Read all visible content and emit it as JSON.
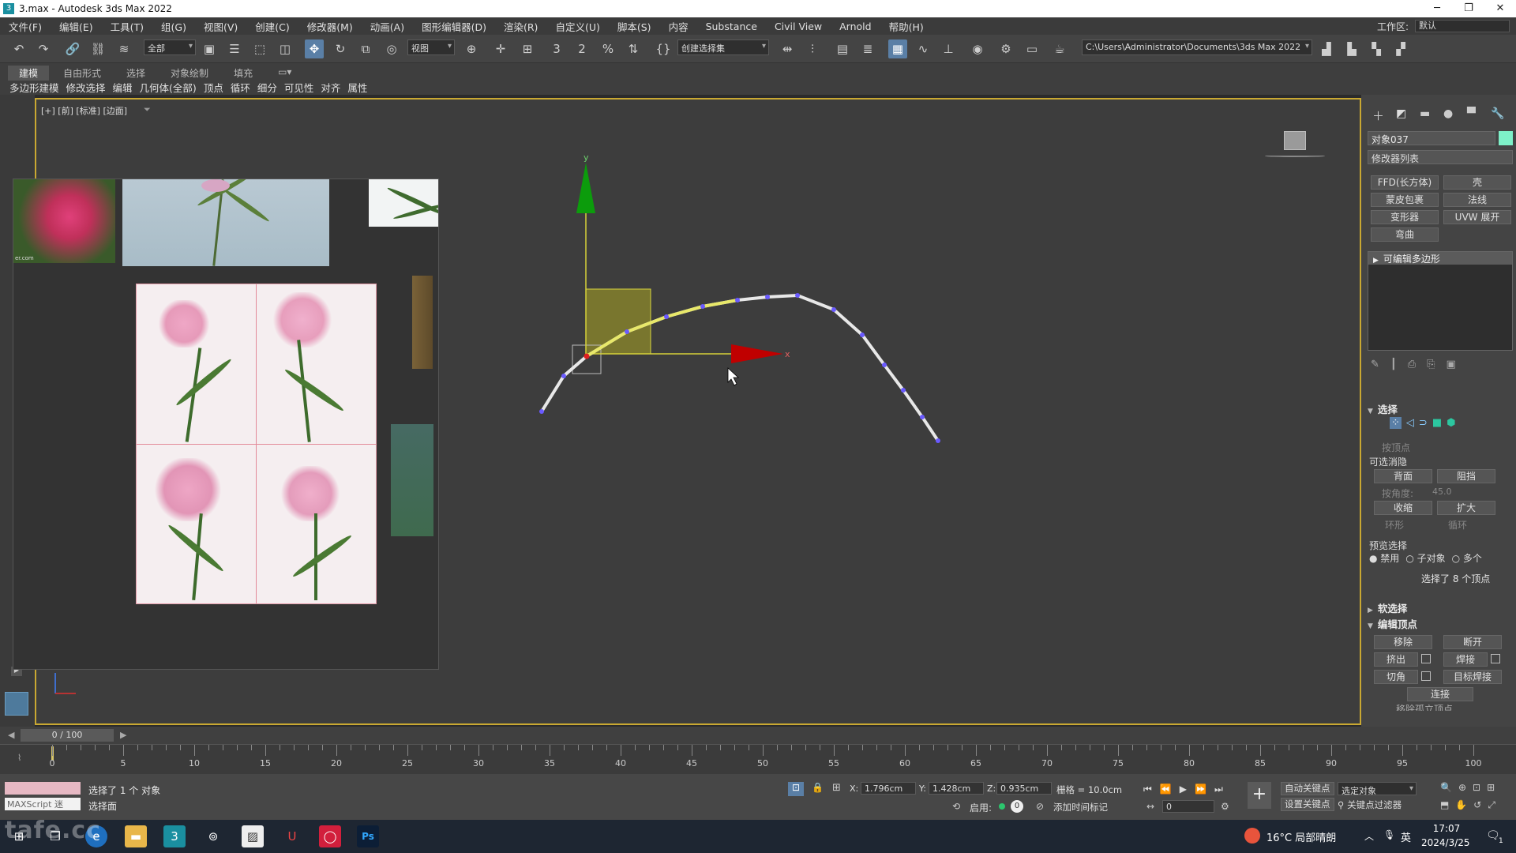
{
  "window": {
    "title": "3.max - Autodesk 3ds Max 2022",
    "minimize": "─",
    "maximize": "❐",
    "close": "✕"
  },
  "menu": [
    "文件(F)",
    "编辑(E)",
    "工具(T)",
    "组(G)",
    "视图(V)",
    "创建(C)",
    "修改器(M)",
    "动画(A)",
    "图形编辑器(D)",
    "渲染(R)",
    "自定义(U)",
    "脚本(S)",
    "内容",
    "Substance",
    "Civil View",
    "Arnold",
    "帮助(H)"
  ],
  "workspace": {
    "label": "工作区:",
    "value": "默认"
  },
  "toolbar": {
    "filter_select": "全部",
    "refcoord_select": "视图",
    "named_selection_set": "创建选择集",
    "project_path": "C:\\Users\\Administrator\\Documents\\3ds Max 2022",
    "snap_3_label": "3",
    "snap_2_label": "2"
  },
  "ribbon": {
    "tabs": [
      "建模",
      "自由形式",
      "选择",
      "对象绘制",
      "填充"
    ],
    "subtabs": [
      "多边形建模",
      "修改选择",
      "编辑",
      "几何体(全部)",
      "顶点",
      "循环",
      "细分",
      "可见性",
      "对齐",
      "属性"
    ]
  },
  "viewport": {
    "label": "[+] [前] [标准] [边面]",
    "gizmo_y": "y",
    "gizmo_x": "x",
    "watermark_text": "er.com"
  },
  "command_panel": {
    "object_name": "对象037",
    "modifier_list": "修改器列表",
    "modifier_buttons": [
      "FFD(长方体)",
      "壳",
      "蒙皮包裹",
      "法线",
      "变形器",
      "UVW 展开",
      "弯曲"
    ],
    "stack_item": "可编辑多边形",
    "selection": {
      "title": "选择",
      "by_vertex": "按顶点",
      "ignore_backface_header": "可选消隐",
      "backface_btn": "背面",
      "occlusion_btn": "阻挡",
      "by_angle": "按角度:",
      "angle_value": "45.0",
      "shrink_btn": "收缩",
      "grow_btn": "扩大",
      "ring_btn": "环形",
      "loop_btn": "循环",
      "preview_header": "预览选择",
      "preview_options": [
        "禁用",
        "子对象",
        "多个"
      ],
      "status": "选择了 8 个顶点"
    },
    "soft_selection": {
      "title": "软选择"
    },
    "edit_vertices": {
      "title": "编辑顶点",
      "buttons": [
        "移除",
        "断开",
        "挤出",
        "焊接",
        "切角",
        "目标焊接",
        "连接"
      ],
      "partial": "移除孤立顶点"
    }
  },
  "timeline": {
    "frame_display": "0 / 100",
    "ticks": [
      0,
      5,
      10,
      15,
      20,
      25,
      30,
      35,
      40,
      45,
      50,
      55,
      60,
      65,
      70,
      75,
      80,
      85,
      90,
      95,
      100
    ]
  },
  "status": {
    "maxscript_label": "MAXScript 迷",
    "selected_objects": "选择了 1 个 对象",
    "prompt": "选择面",
    "x_label": "X:",
    "x_value": "1.796cm",
    "y_label": "Y:",
    "y_value": "1.428cm",
    "z_label": "Z:",
    "z_value": "0.935cm",
    "grid": "栅格 = 10.0cm",
    "enable_label": "启用:",
    "add_time_tag": "添加时间标记",
    "auto_key": "自动关键点",
    "set_key": "设置关键点",
    "key_filter_select": "选定对象",
    "key_filters": "关键点过滤器",
    "frame_field": "0"
  },
  "taskbar": {
    "weather": "16°C 局部晴朗",
    "ime": "英",
    "time": "17:07",
    "date": "2024/3/25",
    "notification_count": "1",
    "ps_label": "Ps"
  },
  "watermark": "tafe.cc",
  "colors": {
    "selection_border": "#c9a832",
    "gizmo_y": "#0c9c0c",
    "gizmo_x": "#c00000",
    "curve": "#e8e8e8",
    "vertex": "#6a5aff",
    "selected_segment": "#e8e86a",
    "plane_handle": "#8e8a2a"
  }
}
